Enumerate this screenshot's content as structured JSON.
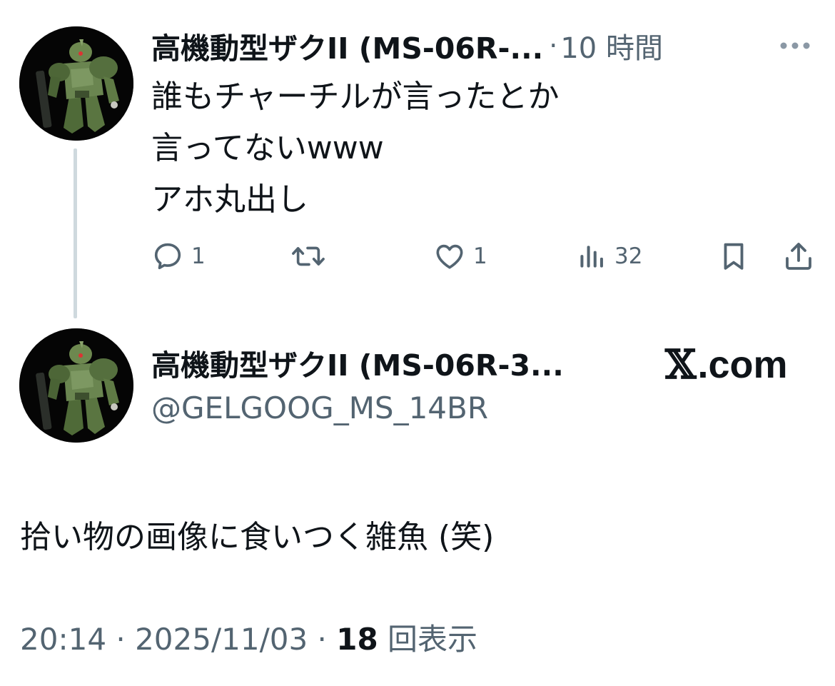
{
  "reply_tweet": {
    "display_name": "高機動型ザクII (MS-06R-...",
    "separator": "·",
    "time": "10 時間",
    "more_label": "···",
    "text_lines": [
      "誰もチャーチルが言ったとか",
      "言ってないwww",
      "アホ丸出し"
    ],
    "actions": {
      "reply_count": "1",
      "retweet_count": "",
      "like_count": "1",
      "views_count": "32"
    },
    "icons": {
      "reply": "comment-icon",
      "retweet": "retweet-icon",
      "like": "heart-icon",
      "views": "analytics-icon",
      "bookmark": "bookmark-icon",
      "share": "share-icon"
    }
  },
  "quoted_tweet": {
    "display_name": "高機動型ザクII (MS-06R-3...",
    "handle": "@GELGOOG_MS_14BR",
    "source_logo": "𝕏",
    "source_domain": ".com",
    "text": "拾い物の画像に食いつく雑魚 (笑)",
    "timestamp": "20:14 · 2025/11/03 · ",
    "views_number": "18",
    "views_label": " 回表示"
  },
  "colors": {
    "text_primary": "#0f1419",
    "text_secondary": "#536471",
    "thread_line": "#cfd9de",
    "avatar_bg": "#050505",
    "mecha_green": "#5f7a45"
  }
}
